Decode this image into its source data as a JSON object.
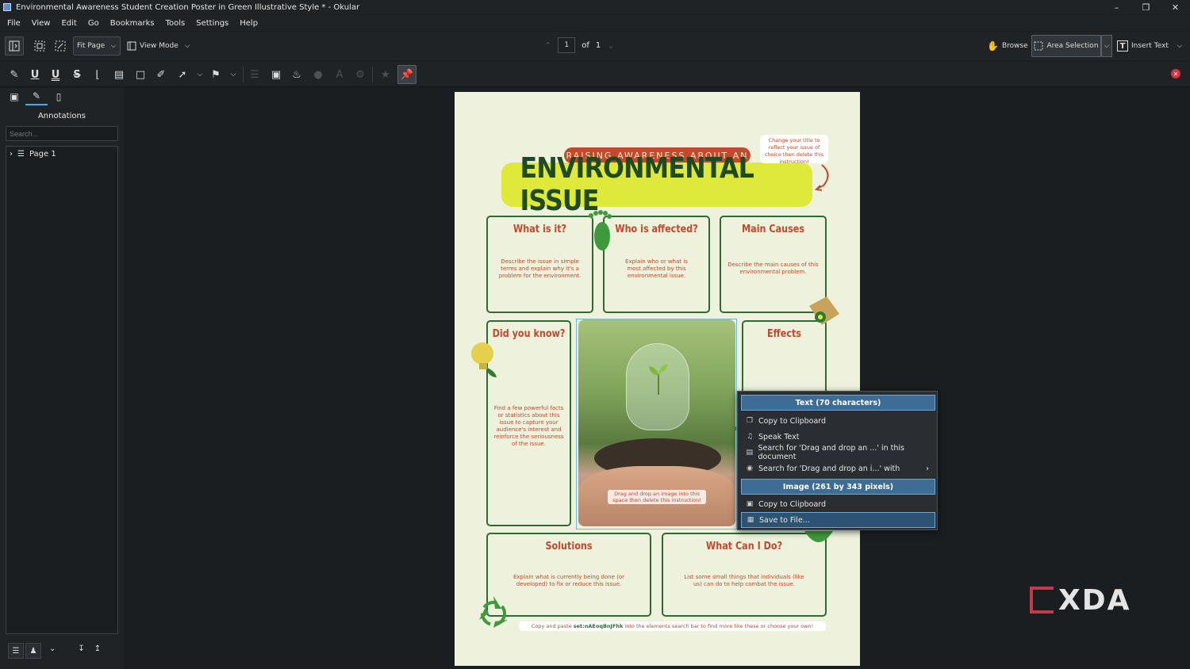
{
  "window": {
    "title": "Environmental Awareness Student Creation Poster in Green Illustrative Style * - Okular"
  },
  "menubar": [
    "File",
    "View",
    "Edit",
    "Go",
    "Bookmarks",
    "Tools",
    "Settings",
    "Help"
  ],
  "toolbar": {
    "zoom_select": "Fit Page",
    "view_mode": "View Mode",
    "page_current": "1",
    "page_of": "of",
    "page_total": "1",
    "browse": "Browse",
    "area_selection": "Area Selection",
    "insert_text": "Insert Text"
  },
  "sidebar": {
    "title": "Annotations",
    "search_placeholder": "Search...",
    "tree_item": "Page 1"
  },
  "poster": {
    "banner": "RAISING AWARENESS ABOUT AN",
    "headline": "ENVIRONMENTAL ISSUE",
    "title_note": "Change your title to reflect your issue of choice then delete this instruction!",
    "boxes": [
      {
        "title": "What is it?",
        "text": "Describe the issue in simple terms and explain why it's a problem for the environment."
      },
      {
        "title": "Who is affected?",
        "text": "Explain who or what is most affected by this environmental issue."
      },
      {
        "title": "Main Causes",
        "text": "Describe the main causes of this environmental problem."
      },
      {
        "title": "Did you know?",
        "text": "Find a few powerful facts or statistics about this issue to capture your audience's interest and reinforce the seriousness of the issue."
      },
      {
        "title": "Effects",
        "text": ""
      },
      {
        "title": "Solutions",
        "text": "Explain what is currently being done (or developed) to fix or reduce this issue."
      },
      {
        "title": "What Can I Do?",
        "text": "List some small things that individuals (like us) can do to help combat the issue."
      }
    ],
    "photo_caption": "Drag and drop an image into this space then delete this instruction!",
    "footer_pre": "Copy and paste ",
    "footer_code": "set:nAEoqBnJFhk",
    "footer_post": " into the elements search bar to find more like these or choose your own!"
  },
  "context_menu": {
    "text_header": "Text (70 characters)",
    "copy_text": "Copy to Clipboard",
    "speak_text": "Speak Text",
    "search_doc": "Search for 'Drag and drop an ...' in this document",
    "search_with": "Search for 'Drag and drop an i...' with",
    "image_header": "Image (261 by 343 pixels)",
    "copy_image": "Copy to Clipboard",
    "save_file": "Save to File..."
  },
  "watermark": "XDA",
  "colors": {
    "accent": "#3daee9",
    "poster_red": "#c2492c",
    "poster_green": "#2f6a35",
    "headline_yellow": "#dfe93a",
    "poster_bg": "#eef2dc",
    "menu_highlight": "#3d6d95"
  }
}
